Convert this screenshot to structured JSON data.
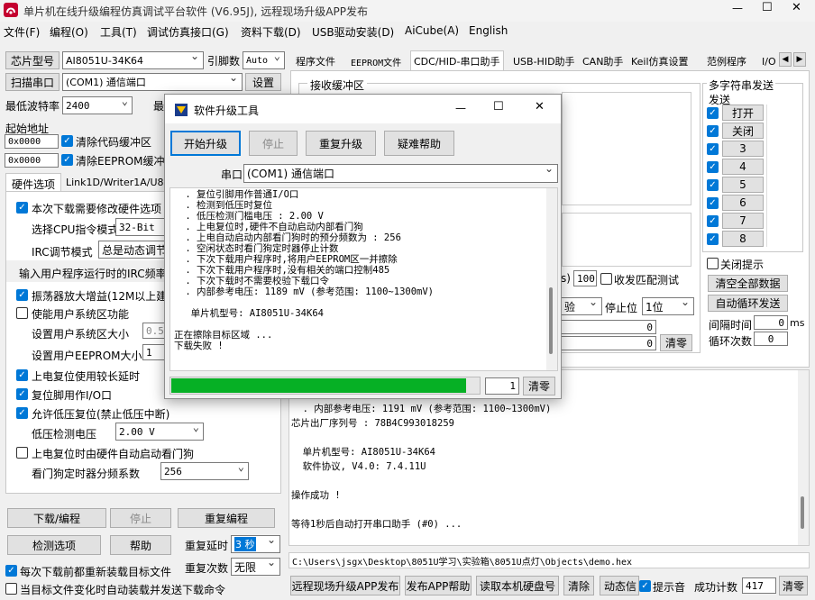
{
  "app": {
    "title": "单片机在线升级编程仿真调试平台软件 (V6.95J), 远程现场升级APP发布",
    "window_controls": [
      "—",
      "☐",
      "✕"
    ]
  },
  "menu": [
    "文件(F)",
    "编程(O)",
    "工具(T)",
    "调试仿真接口(G)",
    "资料下载(D)",
    "USB驱动安装(D)",
    "AiCube(A)",
    "English"
  ],
  "left": {
    "chip_model_btn": "芯片型号",
    "chip_model_value": "AI8051U-34K64",
    "pins_label": "引脚数",
    "pins_value": "Auto",
    "scan_port_btn": "扫描串口",
    "port_value": "(COM1) 通信端口",
    "settings_btn": "设置",
    "min_baud_label": "最低波特率",
    "min_baud_value": "2400",
    "max_baud_label": "最",
    "start_addr_label": "起始地址",
    "addr1": "0x0000",
    "clear_code_label": "清除代码缓冲区",
    "addr2": "0x0000",
    "clear_eeprom_label": "清除EEPROM缓冲区",
    "tabs": [
      "硬件选项",
      "Link1D/Writer1A/U8"
    ],
    "opt_modify_hw": "本次下载需要修改硬件选项",
    "cpu_mode_label": "选择CPU指令模式",
    "cpu_mode_value": "32-Bit",
    "irc_mode_label": "IRC调节模式",
    "irc_mode_value": "总是动态调节",
    "irc_freq_label": "输入用户程序运行时的IRC频率",
    "osc_gain_label": "振荡器放大增益(12M以上建议",
    "user_sys_area_label": "使能用户系统区功能",
    "user_sys_size_label": "设置用户系统区大小",
    "user_sys_size_value": "0.5",
    "user_eeprom_label": "设置用户EEPROM大小",
    "user_eeprom_value": "1",
    "long_reset_label": "上电复位使用较长延时",
    "reset_pin_io_label": "复位脚用作I/O口",
    "low_volt_reset_label": "允许低压复位(禁止低压中断)",
    "low_volt_level_label": "低压检测电压",
    "low_volt_level_value": "2.00 V",
    "wdt_hw_label": "上电复位时由硬件自动启动看门狗",
    "wdt_div_label": "看门狗定时器分频系数",
    "wdt_div_value": "256",
    "download_btn": "下载/编程",
    "stop_btn": "停止",
    "reprogram_btn": "重复编程",
    "check_opts_btn": "检测选项",
    "help_btn": "帮助",
    "repeat_delay_label": "重复延时",
    "repeat_delay_value": "3 秒",
    "repeat_count_label": "重复次数",
    "repeat_count_value": "无限",
    "reload_before_label": "每次下载前都重新装载目标文件",
    "auto_load_label": "当目标文件变化时自动装载并发送下载命令"
  },
  "right": {
    "tabs": [
      "程序文件",
      "EEPROM文件",
      "CDC/HID-串口助手",
      "USB-HID助手",
      "CAN助手",
      "Keil仿真设置",
      "范例程序",
      "I/O"
    ],
    "recv_buffer_label": "接收缓冲区",
    "multi_send_label": "多字符串发送",
    "send_label": "发送",
    "multi_send_items": [
      "打开",
      "关闭",
      "3",
      "4",
      "5",
      "6",
      "7",
      "8"
    ],
    "close_tip_label": "关闭提示",
    "clear_all_btn": "清空全部数据",
    "auto_loop_btn": "自动循环发送",
    "interval_label": "间隔时间",
    "interval_value": "0",
    "interval_unit": "ms",
    "loop_count_label": "循环次数",
    "loop_count_value": "0",
    "timeout_prefix": "s)",
    "timeout_value": "100",
    "match_label": "收发匹配测试",
    "parity_value": "验",
    "stop_bits_label": "停止位",
    "stop_bits_value": "1位",
    "count1_value": "0",
    "count2_value": "0",
    "clear_btn": "清零",
    "log_lines": [
      "  . 内部参考电压: 1191 mV (参考范围: 1100~1300mV)",
      "芯片出厂序列号 : 78B4C993018259",
      "",
      "  单片机型号: AI8051U-34K64",
      "  软件协议, V4.0: 7.4.11U",
      "",
      "操作成功 !",
      "",
      "等待1秒后自动打开串口助手 (#0) ..."
    ],
    "file_path": "C:\\Users\\jsgx\\Desktop\\8051U学习\\实验箱\\8051U点灯\\Objects\\demo.hex"
  },
  "bottom": {
    "publish_app_btn": "远程现场升级APP发布",
    "publish_help_btn": "发布APP帮助",
    "read_disk_btn": "读取本机硬盘号",
    "clear_btn": "清除",
    "dynamic_label": "动态信",
    "beep_label": "提示音",
    "success_count_label": "成功计数",
    "success_count_value": "417",
    "reset_btn": "清零"
  },
  "dialog": {
    "title": "软件升级工具",
    "start_btn": "开始升级",
    "stop_btn": "停止",
    "repeat_btn": "重复升级",
    "help_btn": "疑难帮助",
    "port_label": "串口",
    "port_value": "(COM1) 通信端口",
    "log_lines": [
      " . 复位引脚用作普通I/O口",
      " . 检测到低压时复位",
      " . 低压检测门槛电压 : 2.00 V",
      " . 上电复位时,硬件不自动启动内部看门狗",
      " . 上电自动启动内部看门狗时的预分频数为 : 256",
      " . 空闲状态时看门狗定时器停止计数",
      " . 下次下载用户程序时,将用户EEPROM区一并擦除",
      " . 下次下载用户程序时,没有相关的端口控制485",
      " . 下次下载时不需要校验下载口令",
      " . 内部参考电压: 1189 mV (参考范围: 1100~1300mV)",
      "",
      "  单片机型号: AI8051U-34K64",
      "",
      "正在擦除目标区域 ...",
      "下载失败 !"
    ],
    "progress": 0.96,
    "counter_value": "1",
    "clear_btn": "清零"
  },
  "colors": {
    "progress_fill": "#06b025",
    "checkbox_on": "#0078d7",
    "accent_title_bg": "#f3f3f3"
  }
}
